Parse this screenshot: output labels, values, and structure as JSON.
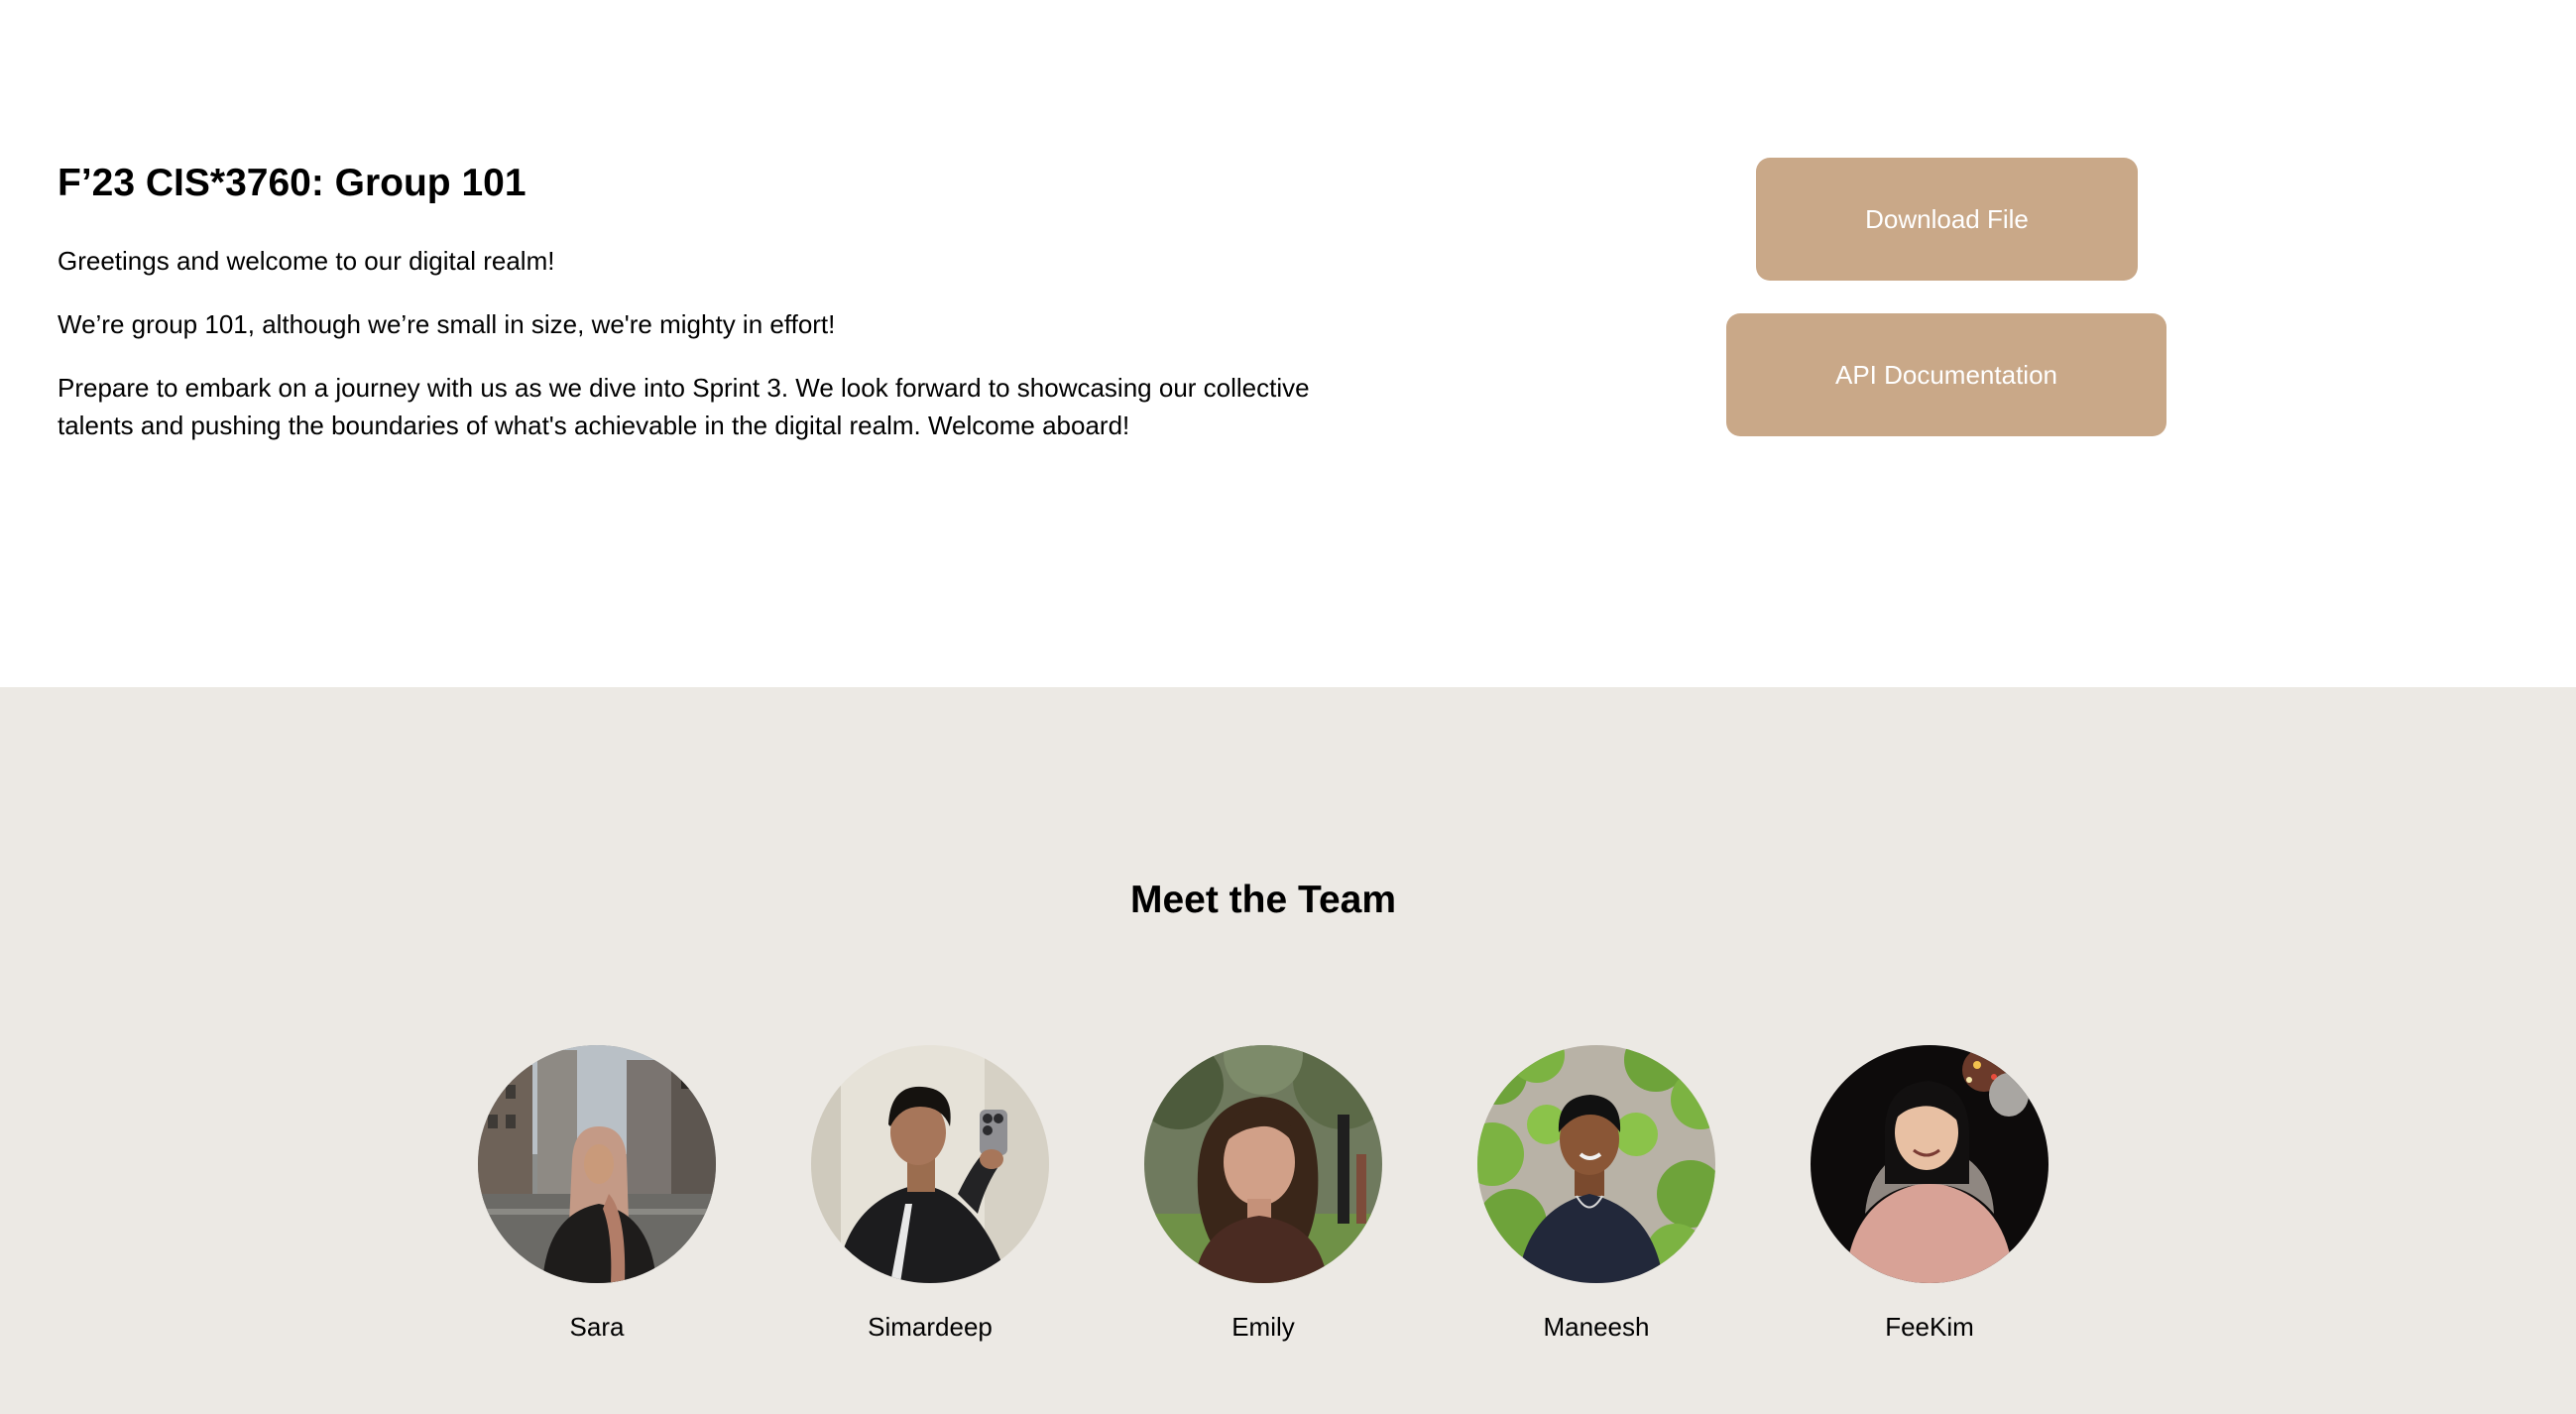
{
  "intro": {
    "title": "F’23 CIS*3760: Group 101",
    "paragraphs": [
      "Greetings and welcome to our digital realm!",
      "We’re group 101, although we’re small in size, we're mighty in effort!",
      "Prepare to embark on a journey with us as we dive into Sprint 3. We look forward to showcasing our collective talents and pushing the boundaries of what's achievable in the digital realm. Welcome aboard!"
    ]
  },
  "actions": {
    "download_label": "Download File",
    "api_label": "API Documentation",
    "button_color": "#c9a888"
  },
  "team": {
    "heading": "Meet the Team",
    "background_color": "#ece9e4",
    "members": [
      {
        "name": "Sara",
        "photo": "city-street-portrait"
      },
      {
        "name": "Simardeep",
        "photo": "mirror-selfie-portrait"
      },
      {
        "name": "Emily",
        "photo": "park-portrait"
      },
      {
        "name": "Maneesh",
        "photo": "ivy-wall-portrait"
      },
      {
        "name": "FeeKim",
        "photo": "night-portrait"
      }
    ]
  }
}
